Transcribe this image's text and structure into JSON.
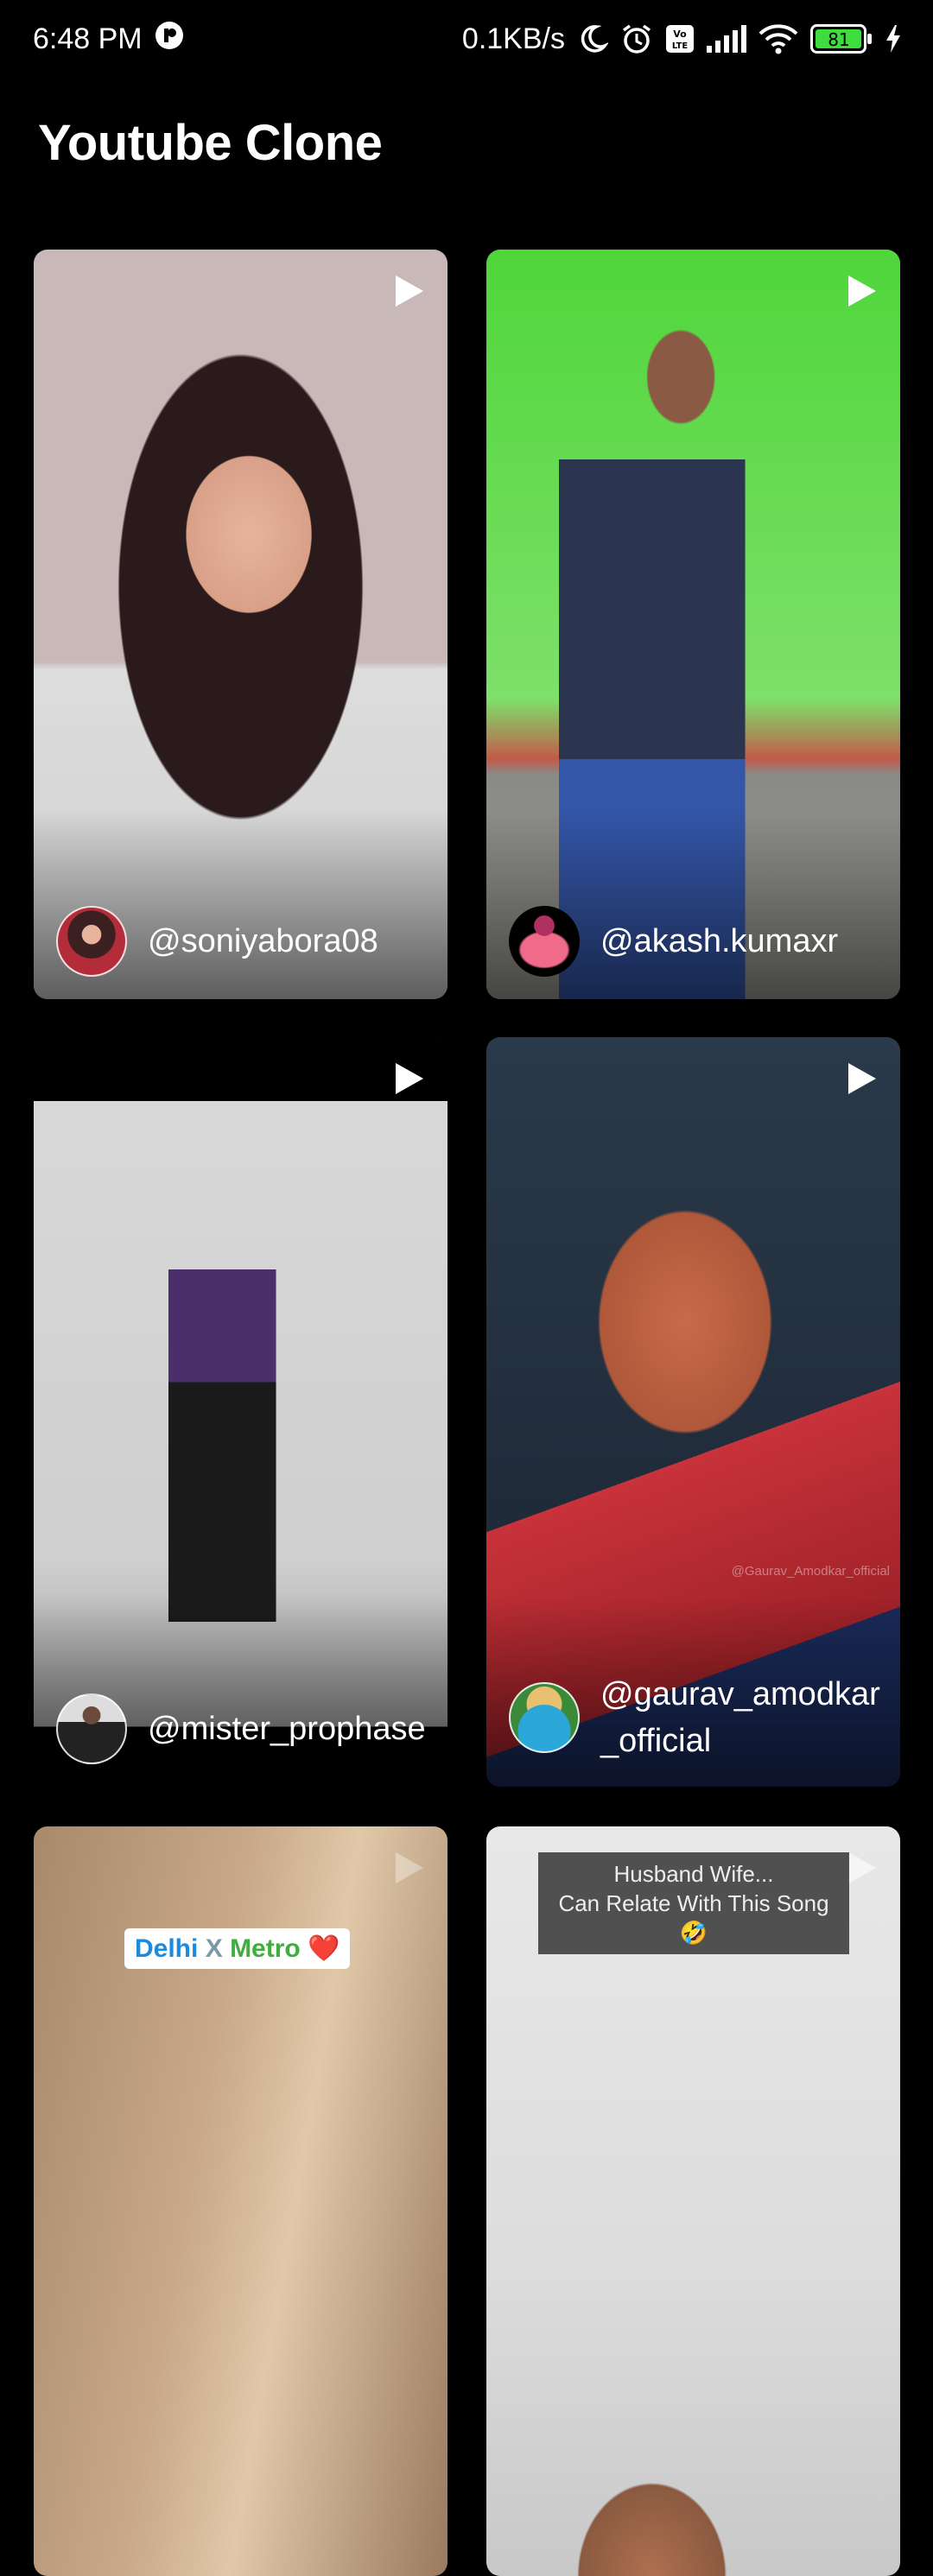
{
  "status_bar": {
    "time": "6:48 PM",
    "network_speed": "0.1KB/s",
    "battery": "81",
    "icons": [
      "app-notification-icon",
      "moon-icon",
      "alarm-icon",
      "volte-icon",
      "signal-icon",
      "wifi-icon",
      "battery-icon",
      "charging-icon"
    ]
  },
  "app": {
    "title": "Youtube Clone"
  },
  "videos": [
    {
      "handle": "@soniyabora08"
    },
    {
      "handle": "@akash.kumaxr"
    },
    {
      "handle": "@mister_prophase"
    },
    {
      "handle": "@gaurav_amodkar_official",
      "watermark": "@Gaurav_Amodkar_official"
    },
    {
      "caption_parts": [
        "Delhi",
        "X",
        "Metro",
        "❤️"
      ]
    },
    {
      "caption_lines": [
        "Husband Wife...",
        "Can Relate With This Song 🤣"
      ]
    }
  ]
}
